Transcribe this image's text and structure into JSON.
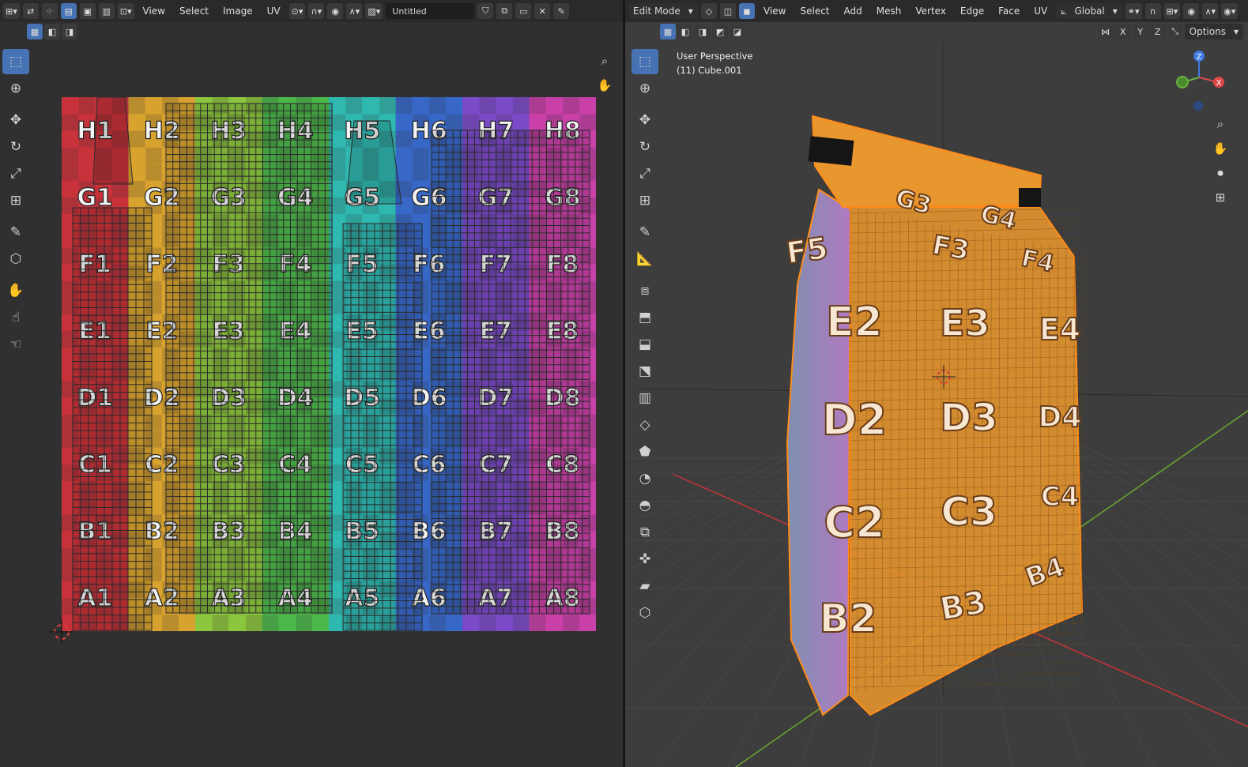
{
  "uv_editor": {
    "editor_type_icon": "uv-editor-icon",
    "menus": [
      "View",
      "Select",
      "Image",
      "UV"
    ],
    "image_name": "Untitled",
    "grid_labels": {
      "rows": [
        "H",
        "G",
        "F",
        "E",
        "D",
        "C",
        "B",
        "A"
      ],
      "cols": [
        "1",
        "2",
        "3",
        "4",
        "5",
        "6",
        "7",
        "8"
      ]
    },
    "colors": {
      "col_hues": [
        "#c8323a",
        "#d8a22e",
        "#8cc63e",
        "#4db84a",
        "#2fb8b0",
        "#3768c8",
        "#7b4ac8",
        "#c840a8"
      ]
    }
  },
  "viewport": {
    "mode": "Edit Mode",
    "menus": [
      "View",
      "Select",
      "Add",
      "Mesh",
      "Vertex",
      "Edge",
      "Face",
      "UV"
    ],
    "transform_orientation": "Global",
    "axis_buttons": [
      "X",
      "Y",
      "Z"
    ],
    "options_label": "Options",
    "overlay_line1": "User Perspective",
    "overlay_line2": "(11) Cube.001",
    "gizmo": {
      "z": "Z",
      "x": "X"
    },
    "bag_labels": [
      {
        "t": "G3"
      },
      {
        "t": "G4"
      },
      {
        "t": "F5"
      },
      {
        "t": "F3"
      },
      {
        "t": "F4"
      },
      {
        "t": "E2"
      },
      {
        "t": "E3"
      },
      {
        "t": "E4"
      },
      {
        "t": "D2"
      },
      {
        "t": "D3"
      },
      {
        "t": "D4"
      },
      {
        "t": "C2"
      },
      {
        "t": "C3"
      },
      {
        "t": "C4"
      },
      {
        "t": "B3"
      },
      {
        "t": "B4"
      },
      {
        "t": "B2"
      }
    ],
    "colors": {
      "bag": "#e8962e",
      "selection": "#ff8c1a",
      "x_axis": "#c8343a",
      "y_axis": "#6ba82e"
    }
  }
}
